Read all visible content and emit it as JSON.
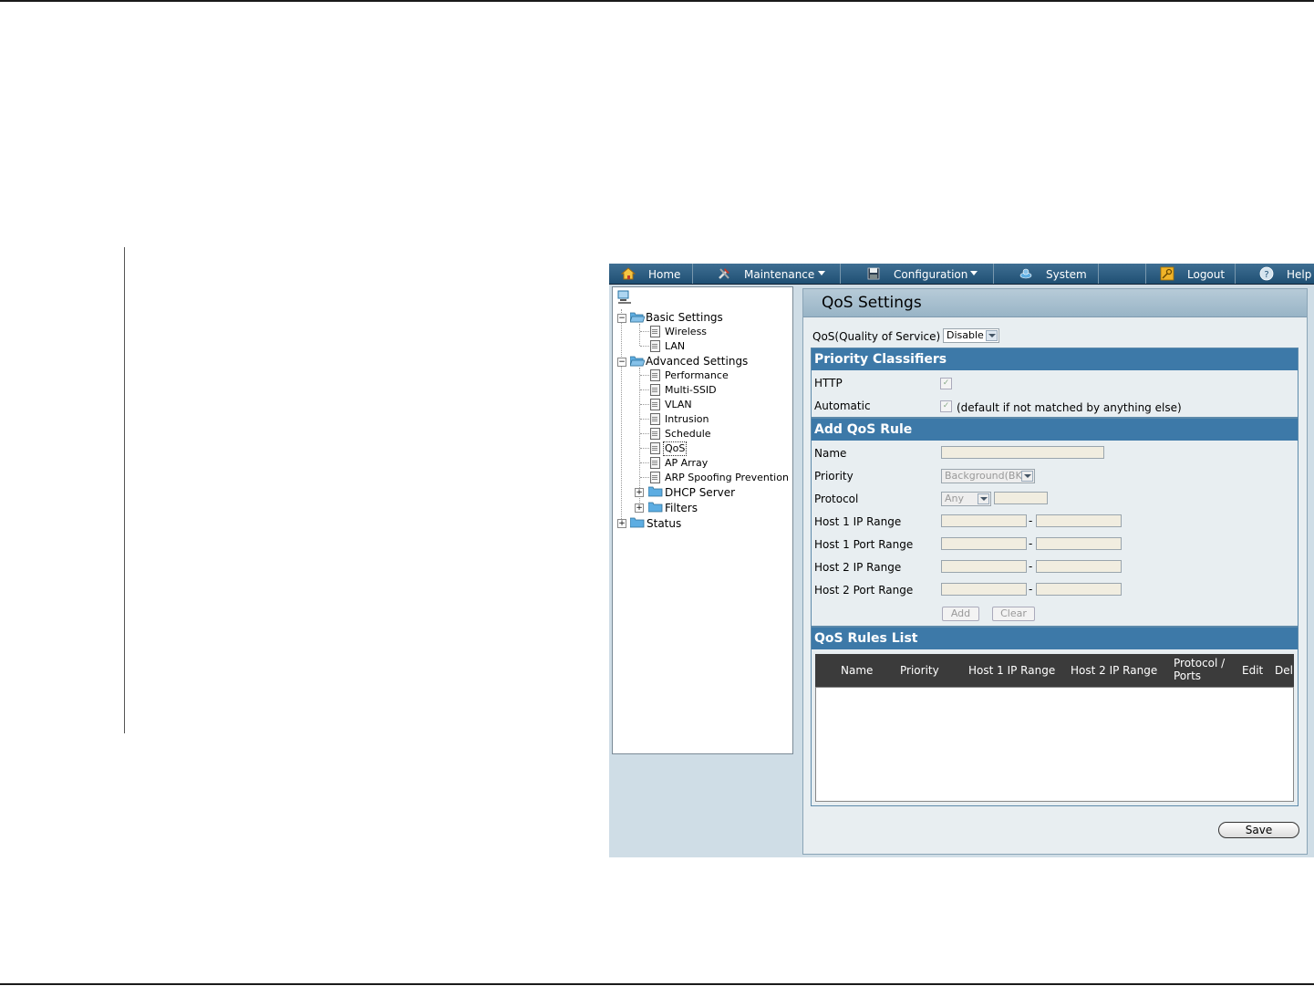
{
  "menubar": {
    "home": "Home",
    "maintenance": "Maintenance",
    "configuration": "Configuration",
    "system": "System",
    "logout": "Logout",
    "help": "Help"
  },
  "tree": {
    "basic_settings": "Basic Settings",
    "wireless": "Wireless",
    "lan": "LAN",
    "advanced_settings": "Advanced Settings",
    "performance": "Performance",
    "multi_ssid": "Multi-SSID",
    "vlan": "VLAN",
    "intrusion": "Intrusion",
    "schedule": "Schedule",
    "qos": "QoS",
    "ap_array": "AP Array",
    "arp_spoofing": "ARP Spoofing Prevention",
    "dhcp_server": "DHCP Server",
    "filters": "Filters",
    "status": "Status",
    "expand_minus": "−",
    "expand_plus": "+"
  },
  "content": {
    "title": "QoS Settings",
    "qos_label": "QoS(Quality of Service)",
    "qos_value": "Disable",
    "priority_classifiers": {
      "header": "Priority Classifiers",
      "http": "HTTP",
      "automatic": "Automatic",
      "automatic_note": "(default if not matched by anything else)"
    },
    "add_rule": {
      "header": "Add QoS Rule",
      "name": "Name",
      "priority": "Priority",
      "priority_value": "Background(BK)",
      "protocol": "Protocol",
      "protocol_value": "Any",
      "host1_ip": "Host 1 IP Range",
      "host1_port": "Host 1 Port Range",
      "host2_ip": "Host 2 IP Range",
      "host2_port": "Host 2 Port Range",
      "range_separator": "-",
      "add_button": "Add",
      "clear_button": "Clear"
    },
    "rules_list": {
      "header": "QoS Rules List",
      "columns": {
        "name": "Name",
        "priority": "Priority",
        "host1": "Host 1 IP Range",
        "host2": "Host 2 IP Range",
        "protocol_line1": "Protocol /",
        "protocol_line2": "Ports",
        "edit": "Edit",
        "del": "Del"
      }
    },
    "save_button": "Save",
    "check_mark": "✓"
  },
  "colors": {
    "menubar": "#2b5b80",
    "panel_header": "#3d79a8",
    "list_header": "#3b3b3b",
    "content_bg": "#e8eef1"
  }
}
